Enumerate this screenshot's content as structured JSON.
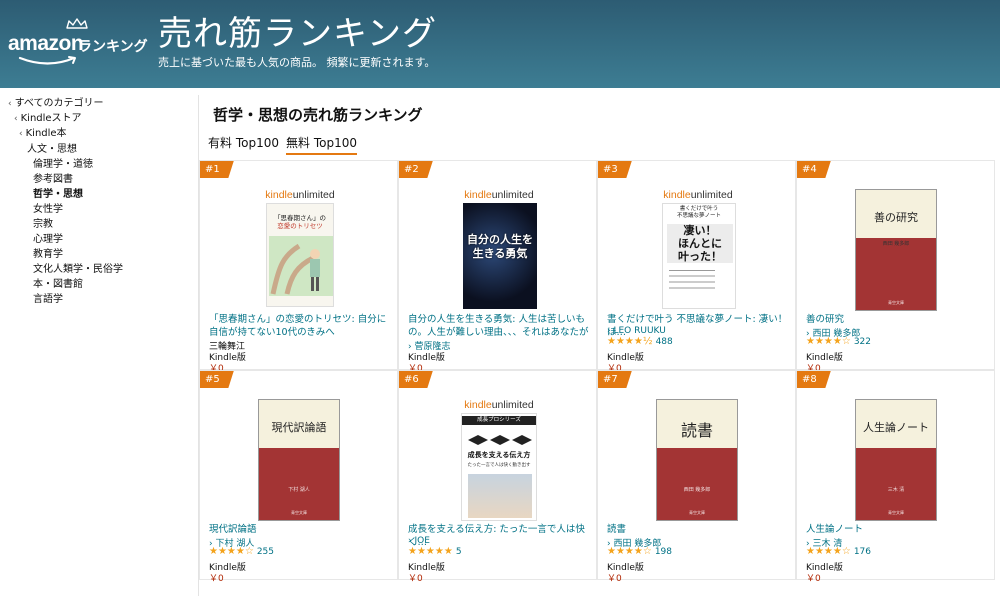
{
  "header": {
    "logo_word": "amazon",
    "logo_sub": "ランキング",
    "title": "売れ筋ランキング",
    "subtitle": "売上に基づいた最も人気の商品。 頻繁に更新されます。"
  },
  "sidebar": {
    "items": [
      {
        "label": "すべてのカテゴリー",
        "chevron": "‹"
      },
      {
        "label": "Kindleストア",
        "chevron": "‹"
      },
      {
        "label": "Kindle本",
        "chevron": "‹"
      },
      {
        "label": "人文・思想",
        "chevron": ""
      },
      {
        "label": "倫理学・道徳",
        "chevron": ""
      },
      {
        "label": "参考図書",
        "chevron": ""
      },
      {
        "label": "哲学・思想",
        "chevron": ""
      },
      {
        "label": "女性学",
        "chevron": ""
      },
      {
        "label": "宗教",
        "chevron": ""
      },
      {
        "label": "心理学",
        "chevron": ""
      },
      {
        "label": "教育学",
        "chevron": ""
      },
      {
        "label": "文化人類学・民俗学",
        "chevron": ""
      },
      {
        "label": "本・図書館",
        "chevron": ""
      },
      {
        "label": "言語学",
        "chevron": ""
      }
    ]
  },
  "main": {
    "page_title": "哲学・思想の売れ筋ランキング",
    "tabs": [
      {
        "label": "有料 Top100"
      },
      {
        "label": "無料 Top100"
      }
    ]
  },
  "products": [
    {
      "rank": "#1",
      "title": "「思春期さん」の恋愛のトリセツ: 自分に自信が持てない10代のきみへ",
      "author": "三輪舞江",
      "format": "Kindle版",
      "price": "￥0",
      "cover_lines": [
        "「思春期さん」の",
        "恋愛のトリセツ"
      ],
      "ku": true
    },
    {
      "rank": "#2",
      "title": "自分の人生を生きる勇気: 人生は苦しいもの。人生が難しい理由、、、それはあなたが創ら…",
      "author": "› 菅原隆志",
      "format": "Kindle版",
      "price": "￥0",
      "cover_lines": [
        "自分の人生を",
        "生きる勇気"
      ],
      "ku": true
    },
    {
      "rank": "#3",
      "title": "書くだけで叶う 不思議な夢ノート: 凄い！ほ…",
      "author": "› LEO RUUKU",
      "rating_stars": "★★★★½",
      "rating_value": 4.5,
      "rating_count": "488",
      "format": "Kindle版",
      "price": "￥0",
      "cover_lines": [
        "書くだけで叶う",
        "不思議な夢ノート",
        "凄い！",
        "ほんとに",
        "叶った！"
      ],
      "ku": true
    },
    {
      "rank": "#4",
      "title": "善の研究",
      "author": "› 西田 幾多郎",
      "rating_stars": "★★★★☆",
      "rating_value": 4.0,
      "rating_count": "322",
      "format": "Kindle版",
      "price": "￥0",
      "cover_lines": [
        "善の研究",
        "西田 幾多郎",
        "青空文庫"
      ],
      "ku": false
    },
    {
      "rank": "#5",
      "title": "現代訳論語",
      "author": "› 下村 湖人",
      "rating_stars": "★★★★☆",
      "rating_value": 4.0,
      "rating_count": "255",
      "format": "Kindle版",
      "price": "￥0",
      "cover_lines": [
        "現代訳論語",
        "下村 湖人",
        "青空文庫"
      ],
      "ku": false
    },
    {
      "rank": "#6",
      "title": "成長を支える伝え方: たった一言で人は快く…",
      "author": "› JOE",
      "rating_stars": "★★★★★",
      "rating_value": 5.0,
      "rating_count": "5",
      "format": "Kindle版",
      "price": "￥0",
      "cover_lines": [
        "成長プロシリーズ",
        "成長を支える伝え方",
        "たった一言で人は快く動き出す"
      ],
      "ku": true
    },
    {
      "rank": "#7",
      "title": "読書",
      "author": "› 西田 幾多郎",
      "rating_stars": "★★★★☆",
      "rating_value": 4.0,
      "rating_count": "198",
      "format": "Kindle版",
      "price": "￥0",
      "cover_lines": [
        "読書",
        "西田 幾多郎",
        "青空文庫"
      ],
      "ku": false
    },
    {
      "rank": "#8",
      "title": "人生論ノート",
      "author": "› 三木 清",
      "rating_stars": "★★★★☆",
      "rating_value": 4.0,
      "rating_count": "176",
      "format": "Kindle版",
      "price": "￥0",
      "cover_lines": [
        "人生論ノート",
        "三木 清",
        "青空文庫"
      ],
      "ku": false
    }
  ],
  "colors": {
    "header_bg": "#3a7489",
    "link": "#007185",
    "badge": "#e47911",
    "price": "#b12704",
    "star": "#f4a31c",
    "classic_cover": "#a33434"
  },
  "icons": [
    "amazon-crown-icon",
    "amazon-smile-icon",
    "chevron-left-icon",
    "star-icon"
  ]
}
